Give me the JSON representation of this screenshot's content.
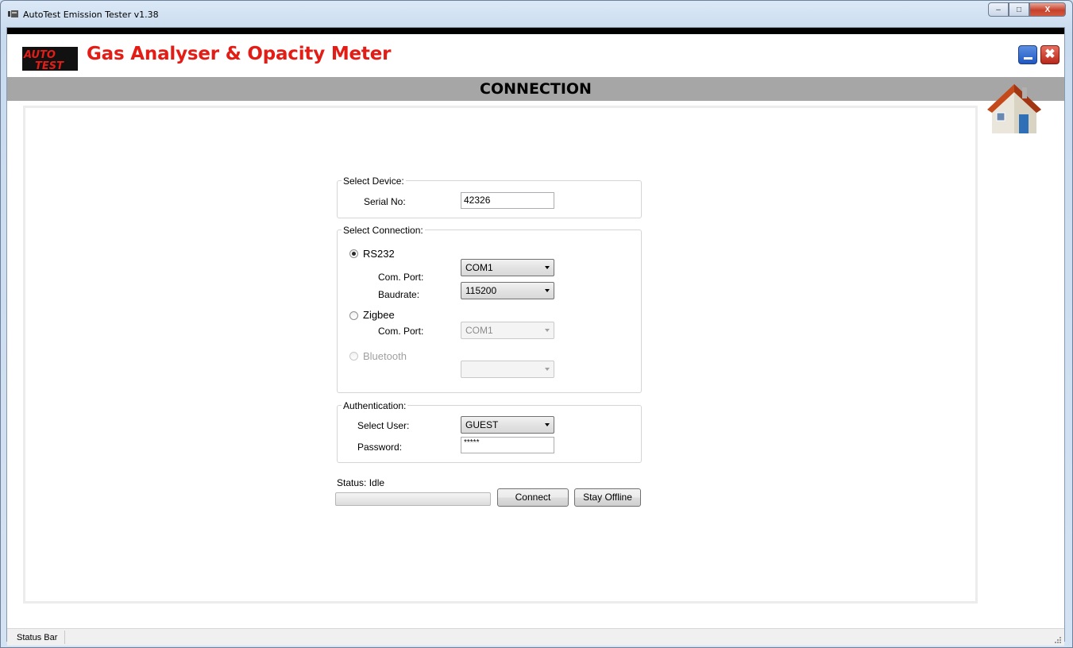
{
  "window": {
    "title": "AutoTest Emission Tester v1.38",
    "caption_minimize": "–",
    "caption_maximize": "□",
    "caption_close": "X"
  },
  "header": {
    "logo_text": "AUTO TEST",
    "app_title": "Gas Analyser & Opacity Meter",
    "close_symbol": "✖",
    "page_title": "CONNECTION"
  },
  "select_device": {
    "legend": "Select Device:",
    "serial_label": "Serial No:",
    "serial_value": "42326"
  },
  "select_connection": {
    "legend": "Select Connection:",
    "rs232": {
      "label": "RS232",
      "checked": true,
      "com_port_label": "Com. Port:",
      "com_port_value": "COM1",
      "baudrate_label": "Baudrate:",
      "baudrate_value": "115200"
    },
    "zigbee": {
      "label": "Zigbee",
      "checked": false,
      "com_port_label": "Com. Port:",
      "com_port_value": "COM1"
    },
    "bluetooth": {
      "label": "Bluetooth",
      "checked": false,
      "value": ""
    }
  },
  "authentication": {
    "legend": "Authentication:",
    "user_label": "Select User:",
    "user_value": "GUEST",
    "password_label": "Password:",
    "password_value": "*****"
  },
  "status": {
    "text": "Status: Idle",
    "progress": 0
  },
  "buttons": {
    "connect": "Connect",
    "stay_offline": "Stay Offline"
  },
  "statusbar": {
    "text": "Status Bar"
  },
  "colors": {
    "title_red": "#e41c16",
    "header_gray": "#a6a6a6"
  }
}
